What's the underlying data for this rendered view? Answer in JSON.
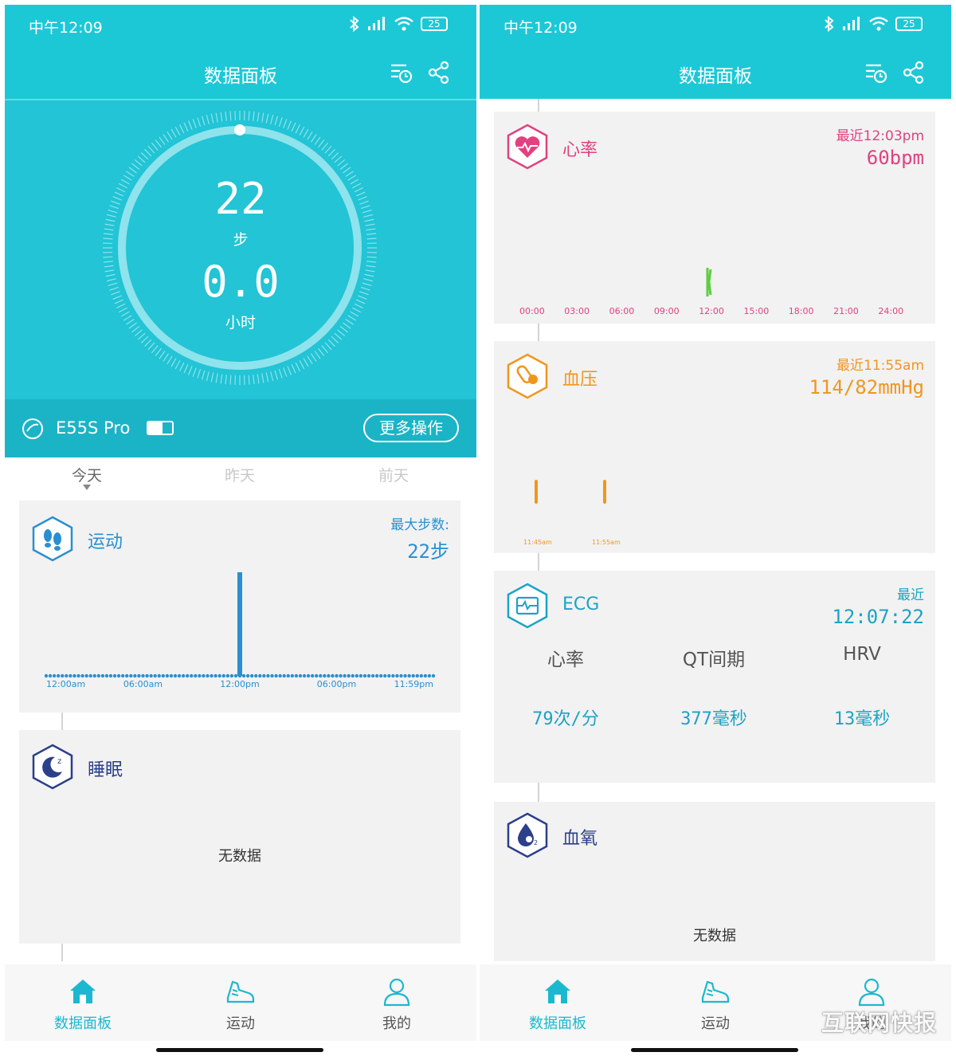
{
  "status": {
    "time": "中午12:09",
    "battery": "25"
  },
  "header": {
    "title": "数据面板"
  },
  "hero": {
    "steps": "22",
    "steps_unit": "步",
    "hours": "0.0",
    "hours_unit": "小时"
  },
  "device": {
    "name": "E55S Pro",
    "more_label": "更多操作"
  },
  "day_tabs": [
    "今天",
    "昨天",
    "前天"
  ],
  "exercise": {
    "title": "运动",
    "max_label": "最大步数:",
    "max_value": "22步",
    "axis": [
      "12:00am",
      "06:00am",
      "12:00pm",
      "06:00pm",
      "11:59pm"
    ],
    "bar_hour": 12,
    "bar_steps": 22
  },
  "sleep": {
    "title": "睡眠",
    "nodata": "无数据"
  },
  "heart": {
    "title": "心率",
    "recent_label": "最近12:03pm",
    "value": "60bpm",
    "axis": [
      "00:00",
      "03:00",
      "06:00",
      "09:00",
      "12:00",
      "15:00",
      "18:00",
      "21:00",
      "24:00"
    ]
  },
  "bp": {
    "title": "血压",
    "recent_label": "最近11:55am",
    "value": "114/82mmHg",
    "axis": [
      "11:45am",
      "11:55am"
    ]
  },
  "ecg": {
    "title": "ECG",
    "recent_label": "最近",
    "recent_time": "12:07:22",
    "cols": [
      {
        "head": "心率",
        "value": "79次/分"
      },
      {
        "head": "QT间期",
        "value": "377毫秒"
      },
      {
        "head": "HRV",
        "value": "13毫秒"
      }
    ]
  },
  "spo2": {
    "title": "血氧",
    "nodata": "无数据"
  },
  "nav": [
    {
      "label": "数据面板"
    },
    {
      "label": "运动"
    },
    {
      "label": "我的"
    }
  ],
  "watermark": "互联网快报",
  "colors": {
    "teal": "#1dc8d6",
    "exercise_blue": "#2a8fd0",
    "heart_pink": "#e2417f",
    "bp_orange": "#f0961e",
    "ecg_teal": "#1da3c4",
    "spo2_indigo": "#2b3f8a"
  }
}
